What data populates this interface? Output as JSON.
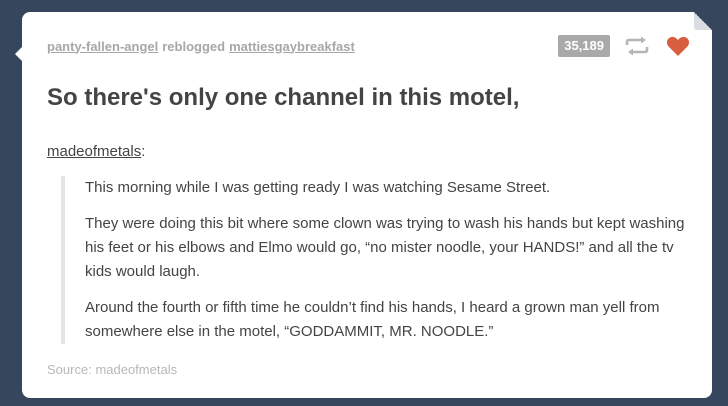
{
  "post": {
    "reblogger": "panty-fallen-angel",
    "reblog_verb": "reblogged",
    "original_blog": "mattiesgaybreakfast",
    "note_count": "35,189",
    "title": "So there's only one channel in this motel,",
    "quote_author": "madeofmetals",
    "quote_paragraphs": [
      "This morning while I was getting ready I was watching Sesame Street.",
      "They were doing this bit where some clown was trying to wash his hands but kept washing his feet or his elbows and Elmo would go, “no mister noodle, your HANDS!” and all the tv kids would laugh.",
      "Around the fourth or fifth time he couldn’t find his hands, I heard a grown man yell from somewhere else in the motel, “GODDAMMIT, MR. NOODLE.”"
    ],
    "source_label": "Source:",
    "source_name": "madeofmetals"
  },
  "icons": {
    "reblog": "reblog-icon",
    "like": "heart-icon"
  },
  "colors": {
    "background": "#36465d",
    "card": "#ffffff",
    "text": "#444444",
    "muted": "#a7a7a7",
    "heart": "#d95e40",
    "note_badge": "#a9a9a9"
  }
}
